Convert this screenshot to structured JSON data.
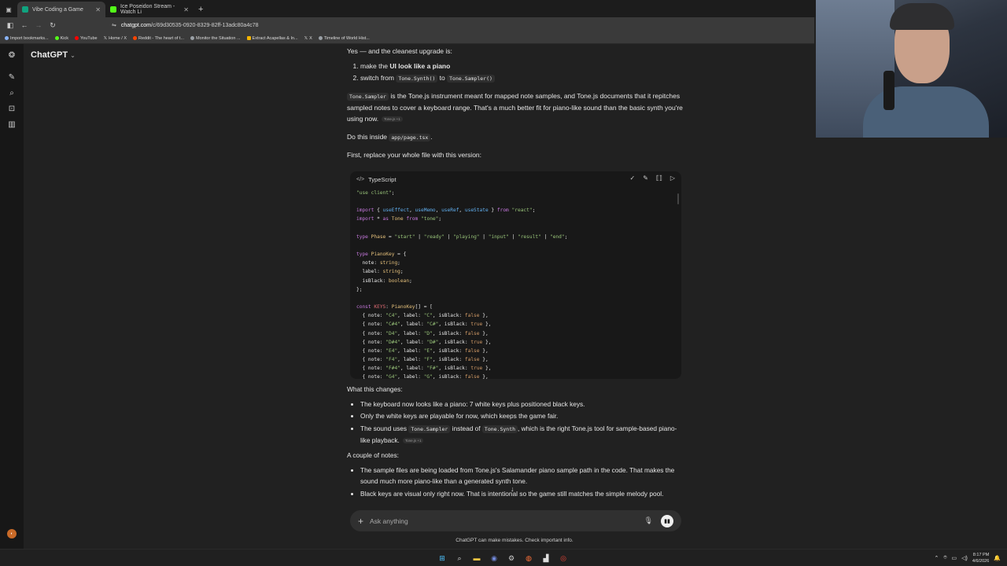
{
  "browser": {
    "tabs": [
      {
        "title": "Vibe Coding a Game",
        "active": true,
        "color": "#10a37f"
      },
      {
        "title": "Ice Poseidon Stream - Watch Li",
        "active": false,
        "color": "#53fc18"
      }
    ],
    "url": {
      "host": "chatgpt.com",
      "path": "/c/69d30535-0920-8329-82ff-13adc80a4c78"
    },
    "bookmarks": [
      {
        "label": "Import bookmarks...",
        "color": "#8ab4f8"
      },
      {
        "label": "Kick",
        "color": "#53fc18"
      },
      {
        "label": "YouTube",
        "color": "#ff0000"
      },
      {
        "label": "Home / X",
        "color": "#ffffff"
      },
      {
        "label": "Reddit - The heart of t...",
        "color": "#ff4500"
      },
      {
        "label": "Monitor the Situation ...",
        "color": "#9aa0a6"
      },
      {
        "label": "Extract Acapellas & In...",
        "color": "#f4b400"
      },
      {
        "label": "X",
        "color": "#ffffff"
      },
      {
        "label": "Timeline of World Hist...",
        "color": "#9aa0a6"
      }
    ]
  },
  "app": {
    "name": "ChatGPT",
    "accent": "#10a37f"
  },
  "message": {
    "intro": "Yes — and the cleanest upgrade is:",
    "steps": [
      {
        "pre": "make the ",
        "bold": "UI look like a piano"
      },
      {
        "pre": "switch from ",
        "code1": "Tone.Synth()",
        "mid": " to ",
        "code2": "Tone.Sampler()"
      }
    ],
    "sampler_code": "Tone.Sampler",
    "sampler_text": " is the Tone.js instrument meant for mapped note samples, and Tone.js documents that it repitches sampled notes to cover a keyboard range. That's a much better fit for piano-like sound than the basic synth you're using now.",
    "cite1": "Tone.js +1",
    "do_this_pre": "Do this inside ",
    "do_this_code": "app/page.tsx",
    "do_this_post": ".",
    "first_replace": "First, replace your whole file with this version:"
  },
  "codeblock": {
    "language": "TypeScript",
    "lines": [
      "\"use client\";",
      "",
      "import { useEffect, useMemo, useRef, useState } from \"react\";",
      "import * as Tone from \"tone\";",
      "",
      "type Phase = \"start\" | \"ready\" | \"playing\" | \"input\" | \"result\" | \"end\";",
      "",
      "type PianoKey = {",
      "  note: string;",
      "  label: string;",
      "  isBlack: boolean;",
      "};",
      "",
      "const KEYS: PianoKey[] = [",
      "  { note: \"C4\", label: \"C\", isBlack: false },",
      "  { note: \"C#4\", label: \"C#\", isBlack: true },",
      "  { note: \"D4\", label: \"D\", isBlack: false },",
      "  { note: \"D#4\", label: \"D#\", isBlack: true },",
      "  { note: \"E4\", label: \"E\", isBlack: false },",
      "  { note: \"F4\", label: \"F\", isBlack: false },",
      "  { note: \"F#4\", label: \"F#\", isBlack: true },",
      "  { note: \"G4\", label: \"G\", isBlack: false },"
    ]
  },
  "changes": {
    "heading": "What this changes:",
    "items": [
      "The keyboard now looks like a piano: 7 white keys plus positioned black keys.",
      "Only the white keys are playable for now, which keeps the game fair."
    ],
    "sound_pre": "The sound uses ",
    "sound_code1": "Tone.Sampler",
    "sound_mid": " instead of ",
    "sound_code2": "Tone.Synth",
    "sound_post": ", which is the right Tone.js tool for sample-based piano-like playback.",
    "cite2": "Tone.js +1"
  },
  "notes": {
    "heading": "A couple of notes:",
    "items": [
      "The sample files are being loaded from Tone.js's Salamander piano sample path in the code. That makes the sound much more piano-like than a generated synth tone.",
      "Black keys are visual only right now. That is intentional so the game still matches the simple melody pool."
    ]
  },
  "composer": {
    "placeholder": "Ask anything"
  },
  "disclaimer": "ChatGPT can make mistakes. Check important info.",
  "taskbar": {
    "time": "8:17 PM",
    "date": "4/6/2026"
  }
}
